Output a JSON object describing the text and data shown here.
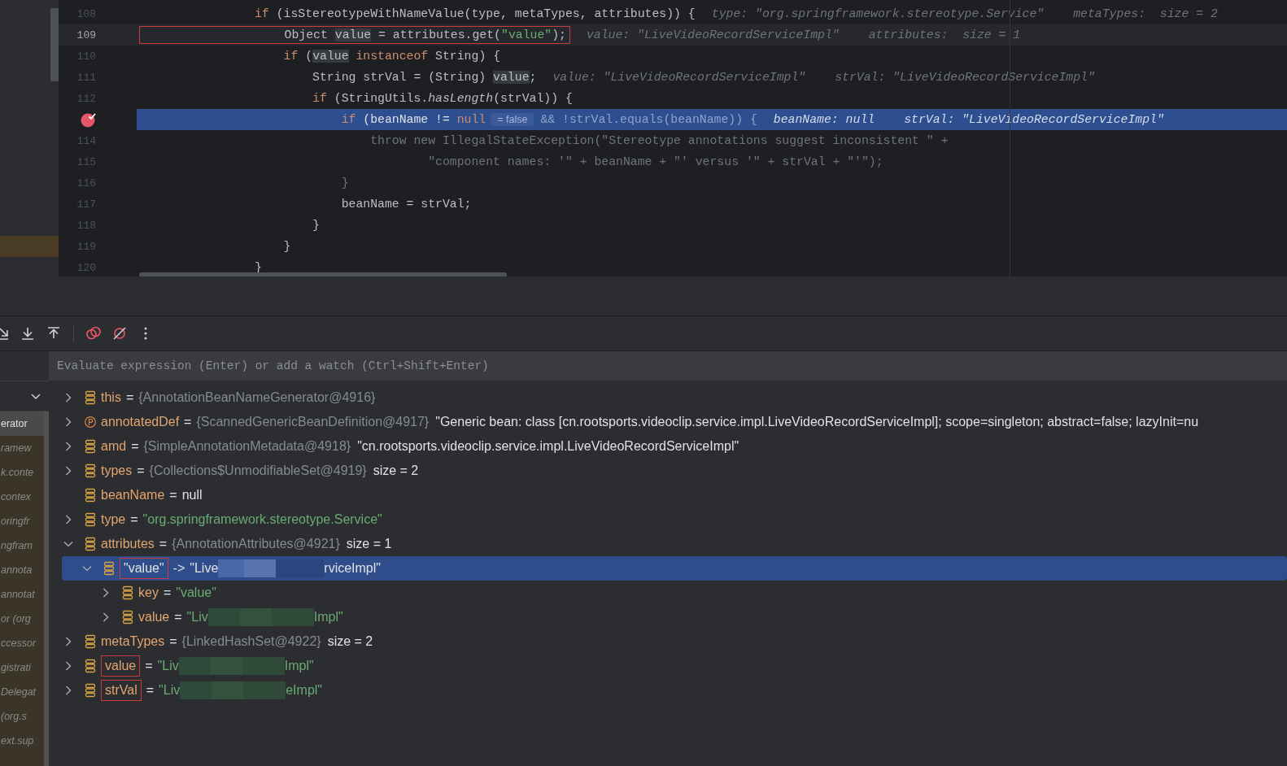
{
  "editor": {
    "lines": [
      {
        "number": "108",
        "current": false,
        "selected": false,
        "breakpoint": false,
        "marked": false,
        "boxed": false,
        "tokens": [
          {
            "kind": "keyword",
            "text": "                if"
          },
          {
            "kind": "plain",
            "text": " (isStereotypeWithNameValue(type, metaTypes, attributes)) {"
          }
        ],
        "hints": [
          "type: \"org.springframework.stereotype.Service\"",
          "metaTypes:  size = 2"
        ]
      },
      {
        "number": "109",
        "current": true,
        "selected": false,
        "breakpoint": false,
        "marked": false,
        "boxed": true,
        "tokens": [
          {
            "kind": "plain",
            "text": "                    Object "
          },
          {
            "kind": "usage",
            "text": "value"
          },
          {
            "kind": "plain",
            "text": " = attributes.get("
          },
          {
            "kind": "string",
            "text": "\"value\""
          },
          {
            "kind": "plain",
            "text": ");"
          }
        ],
        "hints": [
          "value: \"LiveVideoRecordServiceImpl\"",
          "attributes:  size = 1"
        ]
      },
      {
        "number": "110",
        "current": false,
        "selected": false,
        "breakpoint": false,
        "marked": false,
        "boxed": false,
        "tokens": [
          {
            "kind": "keyword",
            "text": "                    if"
          },
          {
            "kind": "plain",
            "text": " ("
          },
          {
            "kind": "usage",
            "text": "value"
          },
          {
            "kind": "keyword",
            "text": " instanceof"
          },
          {
            "kind": "plain",
            "text": " String) {"
          }
        ]
      },
      {
        "number": "111",
        "current": false,
        "selected": false,
        "breakpoint": false,
        "marked": false,
        "boxed": false,
        "tokens": [
          {
            "kind": "plain",
            "text": "                        String strVal = (String) "
          },
          {
            "kind": "usage",
            "text": "value"
          },
          {
            "kind": "plain",
            "text": ";"
          }
        ],
        "hints": [
          "value: \"LiveVideoRecordServiceImpl\"",
          "strVal: \"LiveVideoRecordServiceImpl\""
        ]
      },
      {
        "number": "112",
        "current": false,
        "selected": false,
        "breakpoint": false,
        "marked": false,
        "boxed": false,
        "tokens": [
          {
            "kind": "keyword",
            "text": "                        if"
          },
          {
            "kind": "plain",
            "text": " (StringUtils."
          },
          {
            "kind": "call",
            "text": "hasLength"
          },
          {
            "kind": "plain",
            "text": "(strVal)) {"
          }
        ]
      },
      {
        "current": false,
        "selected": true,
        "breakpoint": true,
        "marked": false,
        "boxed": false,
        "tokens": [
          {
            "kind": "keyword",
            "text": "                            if"
          },
          {
            "kind": "plain",
            "text": " (beanName != "
          },
          {
            "kind": "keyword",
            "text": "null"
          },
          {
            "kind": "badge",
            "text": "= false"
          },
          {
            "kind": "dim",
            "text": "&& !strVal.equals(beanName)) {"
          }
        ],
        "hints": [
          "beanName: null",
          "strVal: \"LiveVideoRecordServiceImpl\""
        ]
      },
      {
        "number": "114",
        "current": false,
        "selected": false,
        "breakpoint": false,
        "marked": false,
        "boxed": false,
        "tokens": [
          {
            "kind": "dim",
            "text": "                                throw new IllegalStateException(\"Stereotype annotations suggest inconsistent \" +"
          }
        ]
      },
      {
        "number": "115",
        "current": false,
        "selected": false,
        "breakpoint": false,
        "marked": false,
        "boxed": false,
        "tokens": [
          {
            "kind": "dim",
            "text": "                                        \"component names: '\" + beanName + \"' versus '\" + strVal + \"'\");"
          }
        ]
      },
      {
        "number": "116",
        "current": false,
        "selected": false,
        "breakpoint": false,
        "marked": false,
        "boxed": false,
        "tokens": [
          {
            "kind": "dim",
            "text": "                            }"
          }
        ]
      },
      {
        "number": "117",
        "current": false,
        "selected": false,
        "breakpoint": false,
        "marked": false,
        "boxed": false,
        "tokens": [
          {
            "kind": "plain",
            "text": "                            beanName = strVal;"
          }
        ]
      },
      {
        "number": "118",
        "current": false,
        "selected": false,
        "breakpoint": false,
        "marked": false,
        "boxed": false,
        "tokens": [
          {
            "kind": "plain",
            "text": "                        }"
          }
        ]
      },
      {
        "number": "119",
        "current": false,
        "selected": false,
        "breakpoint": false,
        "marked": true,
        "boxed": false,
        "tokens": [
          {
            "kind": "plain",
            "text": "                    }"
          }
        ]
      },
      {
        "number": "120",
        "current": false,
        "selected": false,
        "breakpoint": false,
        "marked": false,
        "boxed": false,
        "tokens": [
          {
            "kind": "plain",
            "text": "                }"
          }
        ]
      }
    ]
  },
  "evaluate": {
    "placeholder": "Evaluate expression (Enter) or add a watch (Ctrl+Shift+Enter)"
  },
  "frames": [
    {
      "label": "erator",
      "selected": true
    },
    {
      "label": "ramew",
      "selected": false
    },
    {
      "label": "k.conte",
      "selected": false
    },
    {
      "label": "contex",
      "selected": false
    },
    {
      "label": "oringfr",
      "selected": false
    },
    {
      "label": "ngfram",
      "selected": false
    },
    {
      "label": "annota",
      "selected": false
    },
    {
      "label": "annotat",
      "selected": false
    },
    {
      "label": "or (org",
      "selected": false
    },
    {
      "label": "ccessor",
      "selected": false
    },
    {
      "label": "gistrati",
      "selected": false
    },
    {
      "label": "Delegat",
      "selected": false
    },
    {
      "label": "(org.s",
      "selected": false
    },
    {
      "label": "ext.sup",
      "selected": false
    }
  ],
  "variables": [
    {
      "kind": "field",
      "name": "this",
      "sep": "=",
      "ref": "{AnnotationBeanNameGenerator@4916}",
      "expandable": true,
      "expanded": false,
      "selected": false,
      "boxed": false
    },
    {
      "kind": "property",
      "name": "annotatedDef",
      "sep": "=",
      "ref": "{ScannedGenericBeanDefinition@4917}",
      "value": {
        "kind": "plain",
        "text": "\"Generic bean: class [cn.rootsports.videoclip.service.impl.LiveVideoRecordServiceImpl]; scope=singleton; abstract=false; lazyInit=nu"
      },
      "expandable": true,
      "expanded": false,
      "selected": false,
      "boxed": false
    },
    {
      "kind": "field",
      "name": "amd",
      "sep": "=",
      "ref": "{SimpleAnnotationMetadata@4918}",
      "value": {
        "kind": "plain",
        "text": "\"cn.rootsports.videoclip.service.impl.LiveVideoRecordServiceImpl\""
      },
      "expandable": true,
      "expanded": false,
      "selected": false,
      "boxed": false
    },
    {
      "kind": "field",
      "name": "types",
      "sep": "=",
      "ref": "{Collections$UnmodifiableSet@4919}",
      "value": {
        "kind": "plain",
        "text": "size = 2"
      },
      "expandable": true,
      "expanded": false,
      "selected": false,
      "boxed": false
    },
    {
      "kind": "field",
      "name": "beanName",
      "sep": "=",
      "value": {
        "kind": "plain",
        "text": "null"
      },
      "expandable": false,
      "selected": false,
      "boxed": false
    },
    {
      "kind": "field",
      "name": "type",
      "sep": "=",
      "value": {
        "kind": "string",
        "text": "\"org.springframework.stereotype.Service\""
      },
      "expandable": true,
      "expanded": false,
      "selected": false,
      "boxed": false
    },
    {
      "kind": "field",
      "name": "attributes",
      "sep": "=",
      "ref": "{AnnotationAttributes@4921}",
      "value": {
        "kind": "plain",
        "text": "size = 1"
      },
      "expandable": true,
      "expanded": true,
      "selected": false,
      "boxed": false,
      "children": [
        {
          "kind": "field",
          "name": "\"value\"",
          "sep": "->",
          "value": {
            "kind": "string",
            "text": "\"Live",
            "tail": "rviceImpl\""
          },
          "redacted": true,
          "expandable": true,
          "expanded": true,
          "selected": true,
          "boxed": true,
          "children": [
            {
              "kind": "field",
              "name": "key",
              "sep": "=",
              "value": {
                "kind": "string",
                "text": "\"value\""
              },
              "expandable": true,
              "expanded": false,
              "selected": false,
              "boxed": false
            },
            {
              "kind": "field",
              "name": "value",
              "sep": "=",
              "value": {
                "kind": "string",
                "text": "\"Liv",
                "tail": "Impl\""
              },
              "redacted": true,
              "expandable": true,
              "expanded": false,
              "selected": false,
              "boxed": false
            }
          ]
        }
      ]
    },
    {
      "kind": "field",
      "name": "metaTypes",
      "sep": "=",
      "ref": "{LinkedHashSet@4922}",
      "value": {
        "kind": "plain",
        "text": "size = 2"
      },
      "expandable": true,
      "expanded": false,
      "selected": false,
      "boxed": false
    },
    {
      "kind": "field",
      "name": "value",
      "sep": "=",
      "value": {
        "kind": "string",
        "text": "\"Liv",
        "tail": "Impl\""
      },
      "redacted": true,
      "expandable": true,
      "expanded": false,
      "selected": false,
      "boxed": true
    },
    {
      "kind": "field",
      "name": "strVal",
      "sep": "=",
      "value": {
        "kind": "string",
        "text": "\"Liv",
        "tail": "eImpl\""
      },
      "redacted": true,
      "expandable": true,
      "expanded": false,
      "selected": false,
      "boxed": true
    }
  ]
}
